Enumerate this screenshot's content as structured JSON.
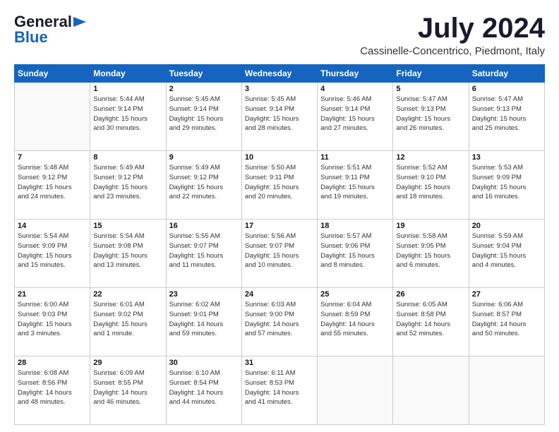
{
  "header": {
    "logo_line1": "General",
    "logo_line2": "Blue",
    "month": "July 2024",
    "location": "Cassinelle-Concentrico, Piedmont, Italy"
  },
  "days_of_week": [
    "Sunday",
    "Monday",
    "Tuesday",
    "Wednesday",
    "Thursday",
    "Friday",
    "Saturday"
  ],
  "weeks": [
    [
      {
        "day": "",
        "info": ""
      },
      {
        "day": "1",
        "info": "Sunrise: 5:44 AM\nSunset: 9:14 PM\nDaylight: 15 hours\nand 30 minutes."
      },
      {
        "day": "2",
        "info": "Sunrise: 5:45 AM\nSunset: 9:14 PM\nDaylight: 15 hours\nand 29 minutes."
      },
      {
        "day": "3",
        "info": "Sunrise: 5:45 AM\nSunset: 9:14 PM\nDaylight: 15 hours\nand 28 minutes."
      },
      {
        "day": "4",
        "info": "Sunrise: 5:46 AM\nSunset: 9:14 PM\nDaylight: 15 hours\nand 27 minutes."
      },
      {
        "day": "5",
        "info": "Sunrise: 5:47 AM\nSunset: 9:13 PM\nDaylight: 15 hours\nand 26 minutes."
      },
      {
        "day": "6",
        "info": "Sunrise: 5:47 AM\nSunset: 9:13 PM\nDaylight: 15 hours\nand 25 minutes."
      }
    ],
    [
      {
        "day": "7",
        "info": "Sunrise: 5:48 AM\nSunset: 9:12 PM\nDaylight: 15 hours\nand 24 minutes."
      },
      {
        "day": "8",
        "info": "Sunrise: 5:49 AM\nSunset: 9:12 PM\nDaylight: 15 hours\nand 23 minutes."
      },
      {
        "day": "9",
        "info": "Sunrise: 5:49 AM\nSunset: 9:12 PM\nDaylight: 15 hours\nand 22 minutes."
      },
      {
        "day": "10",
        "info": "Sunrise: 5:50 AM\nSunset: 9:11 PM\nDaylight: 15 hours\nand 20 minutes."
      },
      {
        "day": "11",
        "info": "Sunrise: 5:51 AM\nSunset: 9:11 PM\nDaylight: 15 hours\nand 19 minutes."
      },
      {
        "day": "12",
        "info": "Sunrise: 5:52 AM\nSunset: 9:10 PM\nDaylight: 15 hours\nand 18 minutes."
      },
      {
        "day": "13",
        "info": "Sunrise: 5:53 AM\nSunset: 9:09 PM\nDaylight: 15 hours\nand 16 minutes."
      }
    ],
    [
      {
        "day": "14",
        "info": "Sunrise: 5:54 AM\nSunset: 9:09 PM\nDaylight: 15 hours\nand 15 minutes."
      },
      {
        "day": "15",
        "info": "Sunrise: 5:54 AM\nSunset: 9:08 PM\nDaylight: 15 hours\nand 13 minutes."
      },
      {
        "day": "16",
        "info": "Sunrise: 5:55 AM\nSunset: 9:07 PM\nDaylight: 15 hours\nand 11 minutes."
      },
      {
        "day": "17",
        "info": "Sunrise: 5:56 AM\nSunset: 9:07 PM\nDaylight: 15 hours\nand 10 minutes."
      },
      {
        "day": "18",
        "info": "Sunrise: 5:57 AM\nSunset: 9:06 PM\nDaylight: 15 hours\nand 8 minutes."
      },
      {
        "day": "19",
        "info": "Sunrise: 5:58 AM\nSunset: 9:05 PM\nDaylight: 15 hours\nand 6 minutes."
      },
      {
        "day": "20",
        "info": "Sunrise: 5:59 AM\nSunset: 9:04 PM\nDaylight: 15 hours\nand 4 minutes."
      }
    ],
    [
      {
        "day": "21",
        "info": "Sunrise: 6:00 AM\nSunset: 9:03 PM\nDaylight: 15 hours\nand 3 minutes."
      },
      {
        "day": "22",
        "info": "Sunrise: 6:01 AM\nSunset: 9:02 PM\nDaylight: 15 hours\nand 1 minute."
      },
      {
        "day": "23",
        "info": "Sunrise: 6:02 AM\nSunset: 9:01 PM\nDaylight: 14 hours\nand 59 minutes."
      },
      {
        "day": "24",
        "info": "Sunrise: 6:03 AM\nSunset: 9:00 PM\nDaylight: 14 hours\nand 57 minutes."
      },
      {
        "day": "25",
        "info": "Sunrise: 6:04 AM\nSunset: 8:59 PM\nDaylight: 14 hours\nand 55 minutes."
      },
      {
        "day": "26",
        "info": "Sunrise: 6:05 AM\nSunset: 8:58 PM\nDaylight: 14 hours\nand 52 minutes."
      },
      {
        "day": "27",
        "info": "Sunrise: 6:06 AM\nSunset: 8:57 PM\nDaylight: 14 hours\nand 50 minutes."
      }
    ],
    [
      {
        "day": "28",
        "info": "Sunrise: 6:08 AM\nSunset: 8:56 PM\nDaylight: 14 hours\nand 48 minutes."
      },
      {
        "day": "29",
        "info": "Sunrise: 6:09 AM\nSunset: 8:55 PM\nDaylight: 14 hours\nand 46 minutes."
      },
      {
        "day": "30",
        "info": "Sunrise: 6:10 AM\nSunset: 8:54 PM\nDaylight: 14 hours\nand 44 minutes."
      },
      {
        "day": "31",
        "info": "Sunrise: 6:11 AM\nSunset: 8:53 PM\nDaylight: 14 hours\nand 41 minutes."
      },
      {
        "day": "",
        "info": ""
      },
      {
        "day": "",
        "info": ""
      },
      {
        "day": "",
        "info": ""
      }
    ]
  ]
}
